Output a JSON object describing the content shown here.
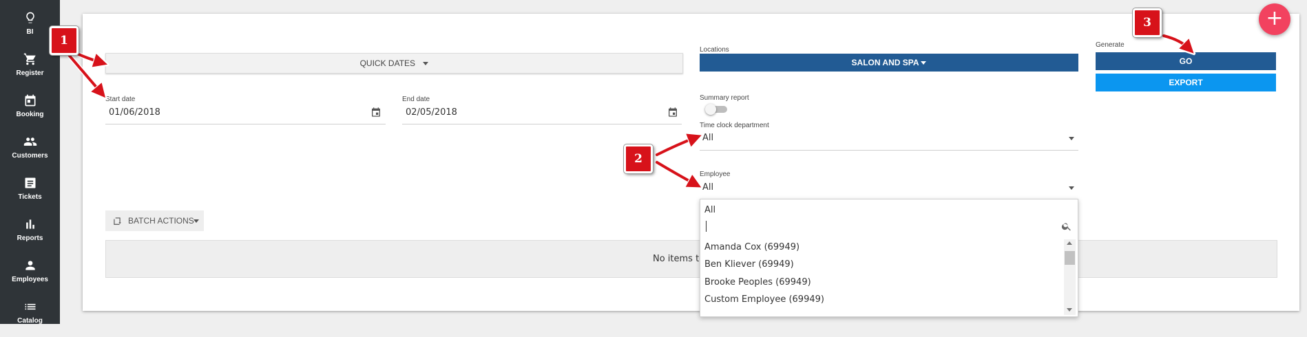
{
  "sidebar": {
    "items": [
      {
        "label": "BI",
        "icon": "lightbulb-icon"
      },
      {
        "label": "Register",
        "icon": "cart-icon"
      },
      {
        "label": "Booking",
        "icon": "calendar-icon"
      },
      {
        "label": "Customers",
        "icon": "people-icon"
      },
      {
        "label": "Tickets",
        "icon": "ticket-icon"
      },
      {
        "label": "Reports",
        "icon": "bar-chart-icon"
      },
      {
        "label": "Employees",
        "icon": "person-icon"
      },
      {
        "label": "Catalog",
        "icon": "list-icon"
      }
    ]
  },
  "form": {
    "quick_dates_label": "QUICK DATES",
    "start_date_label": "Start date",
    "start_date_value": "01/06/2018",
    "end_date_label": "End date",
    "end_date_value": "02/05/2018",
    "locations_label": "Locations",
    "locations_value": "SALON AND SPA",
    "summary_report_label": "Summary report",
    "time_clock_label": "Time clock department",
    "time_clock_value": "All",
    "employee_label": "Employee",
    "employee_value": "All",
    "generate_label": "Generate",
    "go_label": "GO",
    "export_label": "EXPORT",
    "batch_actions_label": "BATCH ACTIONS",
    "no_items_text": "No items to"
  },
  "employee_dropdown": {
    "first_option": "All",
    "search_value": "",
    "options": [
      "Amanda Cox (69949)",
      "Ben Kliever (69949)",
      "Brooke Peoples (69949)",
      "Custom Employee (69949)"
    ]
  },
  "annotations": [
    "1",
    "2",
    "3"
  ],
  "colors": {
    "sidebar": "#2f3438",
    "primary": "#225b94",
    "export": "#0b96f0",
    "fab": "#f2425f",
    "annotation": "#d7121a"
  }
}
